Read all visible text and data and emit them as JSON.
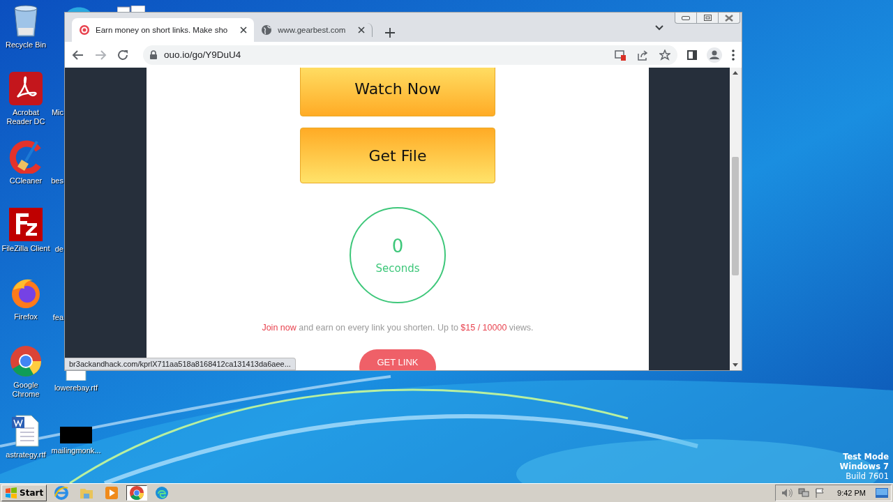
{
  "desktop": {
    "icons": [
      {
        "label": "Recycle Bin",
        "kind": "recycle"
      },
      {
        "label": "Acrobat\nReader DC",
        "kind": "pdf"
      },
      {
        "label": "CCleaner",
        "kind": "ccleaner"
      },
      {
        "label": "FileZilla Client",
        "kind": "filezilla"
      },
      {
        "label": "Firefox",
        "kind": "firefox"
      },
      {
        "label": "Google\nChrome",
        "kind": "chrome"
      },
      {
        "label": "astrategy.rtf",
        "kind": "word"
      },
      {
        "label": "Mic",
        "kind": "covered"
      },
      {
        "label": "bes",
        "kind": "covered"
      },
      {
        "label": "de",
        "kind": "covered"
      },
      {
        "label": "fea",
        "kind": "covered"
      },
      {
        "label": "lowerebay.rtf",
        "kind": "doc"
      },
      {
        "label": "mailingmonk...",
        "kind": "black"
      }
    ],
    "notice": [
      "Test Mode",
      "Windows 7",
      "Build 7601"
    ]
  },
  "browser": {
    "tabs": [
      {
        "title": "Earn money on short links. Make sho",
        "kind": "target",
        "selected": true
      },
      {
        "title": "www.gearbest.com",
        "kind": "globe",
        "selected": false
      }
    ],
    "nav": [
      {
        "kind": "back",
        "disabled": false
      },
      {
        "kind": "forward",
        "disabled": true
      },
      {
        "kind": "reload",
        "disabled": false
      }
    ],
    "address": "ouo.io/go/Y9DuU4",
    "status_url": "br3ackandhack.com/kprlX711aa518a8168412ca131413da6aee..."
  },
  "page": {
    "buttons": [
      {
        "label": "Watch Now",
        "kind": "down"
      },
      {
        "label": "Get File",
        "kind": "up"
      }
    ],
    "timer": {
      "value": "0",
      "unit": "Seconds"
    },
    "promo": [
      {
        "text": "Join now",
        "kind": "link"
      },
      {
        "text": " and earn on every link you shorten. Up to ",
        "kind": "plain"
      },
      {
        "text": "$15 / 10000",
        "kind": "highlight"
      },
      {
        "text": " views.",
        "kind": "plain"
      }
    ],
    "cta": "GET LINK"
  },
  "taskbar": {
    "start": "Start",
    "apps": [
      {
        "kind": "ie",
        "selected": false
      },
      {
        "kind": "folder",
        "selected": false
      },
      {
        "kind": "media",
        "selected": false
      },
      {
        "kind": "chrome",
        "selected": true
      },
      {
        "kind": "edge",
        "selected": false
      }
    ],
    "clock": "9:42 PM"
  }
}
